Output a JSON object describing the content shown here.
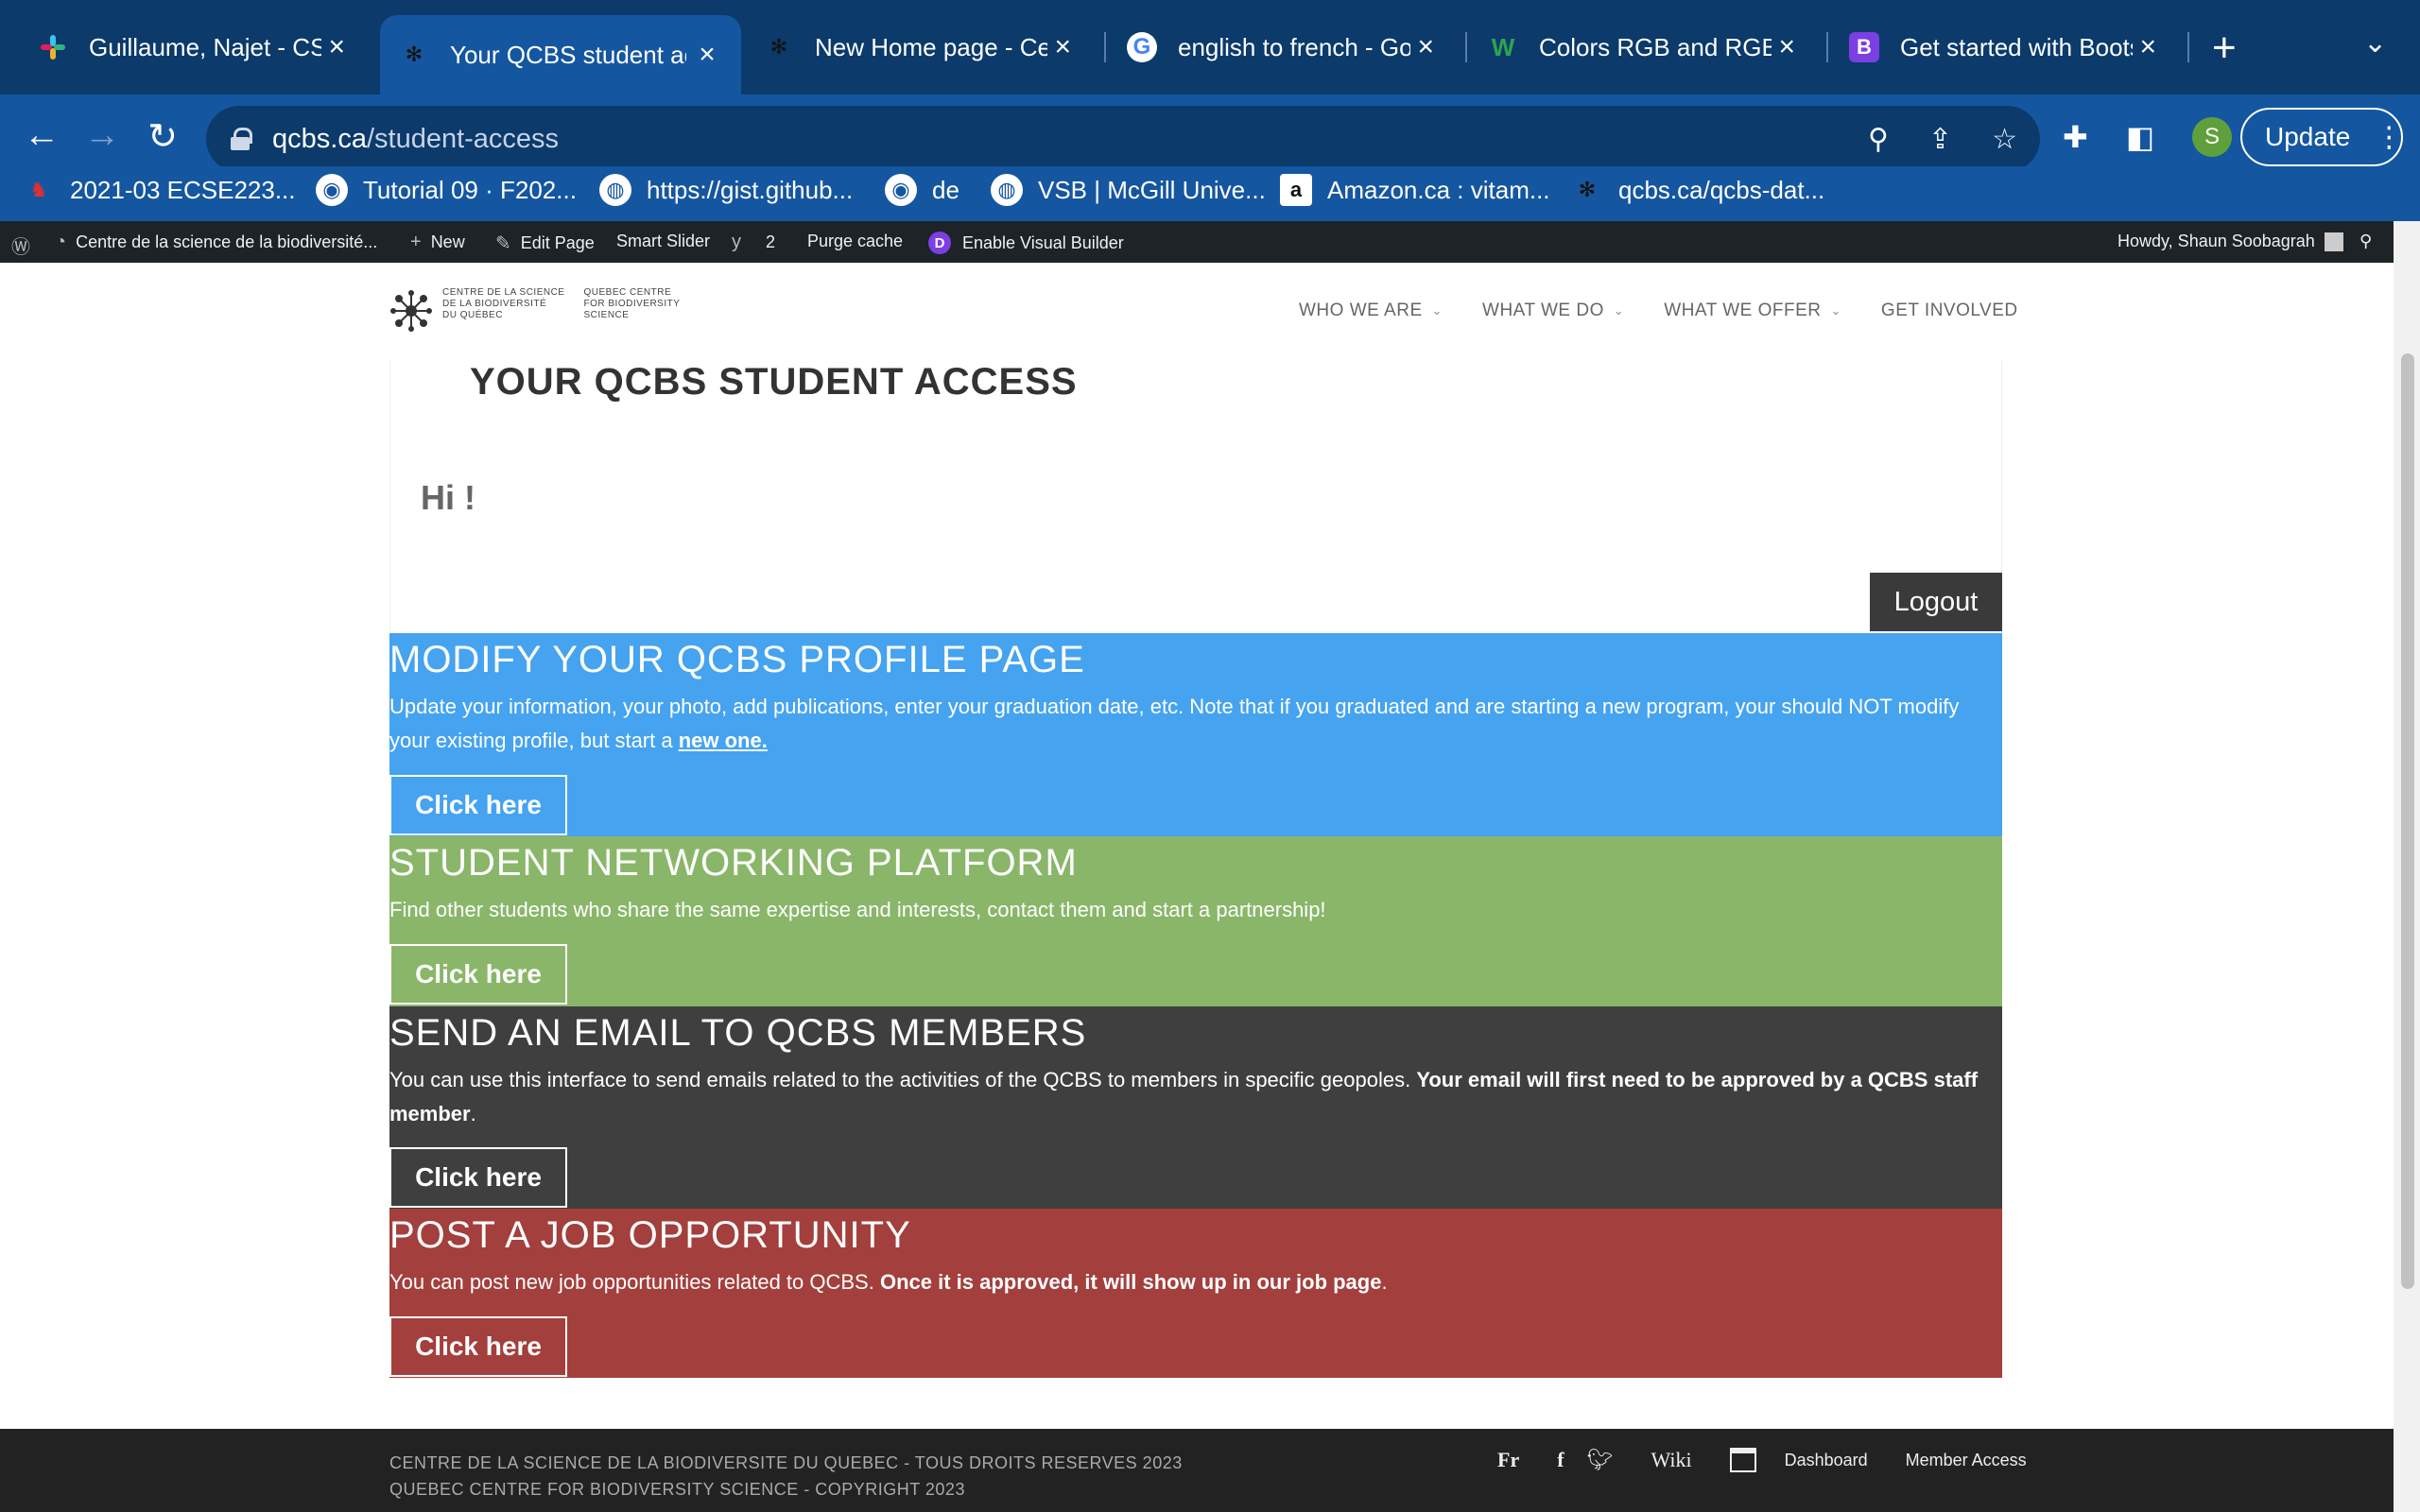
{
  "browser": {
    "tabs": [
      {
        "title": "Guillaume, Najet - CSB",
        "favicon": "slack-icon",
        "active": false
      },
      {
        "title": "Your QCBS student acc",
        "favicon": "qcbs-icon",
        "active": true
      },
      {
        "title": "New Home page - Centr",
        "favicon": "qcbs-icon",
        "active": false
      },
      {
        "title": "english to french - Goo",
        "favicon": "google-icon",
        "active": false
      },
      {
        "title": "Colors RGB and RGBA",
        "favicon": "w3schools-icon",
        "active": false
      },
      {
        "title": "Get started with Boots",
        "favicon": "bootstrap-icon",
        "active": false
      }
    ],
    "url_host": "qcbs.ca",
    "url_path": "/student-access",
    "profile_initial": "S",
    "update_label": "Update",
    "bookmarks": [
      {
        "label": "2021-03 ECSE223...",
        "icon": "sheep-icon"
      },
      {
        "label": "Tutorial 09 · F202...",
        "icon": "github-icon"
      },
      {
        "label": "https://gist.github...",
        "icon": "globe-icon"
      },
      {
        "label": "de",
        "icon": "github-icon"
      },
      {
        "label": "VSB | McGill Unive...",
        "icon": "globe-icon"
      },
      {
        "label": "Amazon.ca : vitam...",
        "icon": "amazon-icon"
      },
      {
        "label": "qcbs.ca/qcbs-dat...",
        "icon": "qcbs-icon"
      }
    ]
  },
  "adminbar": {
    "site_name": "Centre de la science de la biodiversité...",
    "new_label": "New",
    "edit_page": "Edit Page",
    "smart_slider": "Smart Slider",
    "yoast_count": "2",
    "purge_cache": "Purge cache",
    "visual_builder": "Enable Visual Builder",
    "howdy": "Howdy, Shaun Soobagrah"
  },
  "site": {
    "logo_fr": [
      "CENTRE DE LA SCIENCE",
      "DE LA BIODIVERSITÉ",
      "DU QUÉBEC"
    ],
    "logo_en": [
      "QUEBEC CENTRE",
      "FOR BIODIVERSITY",
      "SCIENCE"
    ],
    "nav": [
      {
        "label": "WHO WE ARE",
        "dropdown": true
      },
      {
        "label": "WHAT WE DO",
        "dropdown": true
      },
      {
        "label": "WHAT WE OFFER",
        "dropdown": true
      },
      {
        "label": "GET INVOLVED",
        "dropdown": false
      }
    ]
  },
  "content": {
    "page_title": "YOUR QCBS STUDENT ACCESS",
    "greeting": "Hi !",
    "logout_label": "Logout",
    "sections": [
      {
        "title": "MODIFY YOUR QCBS PROFILE PAGE",
        "body": "Update your information, your photo, add publications, enter your graduation date, etc. Note that if you graduated and are starting a new program, your should NOT modify your existing profile, but start a ",
        "link": "new one.",
        "button": "Click here",
        "color": "#45a3f0"
      },
      {
        "title": "STUDENT NETWORKING PLATFORM",
        "body": "Find other students who share the same expertise and interests, contact them and start a partnership!",
        "button": "Click here",
        "color": "#8ab66a"
      },
      {
        "title": "SEND AN EMAIL TO QCBS MEMBERS",
        "body": "You can use this interface to send emails related to the activities of the QCBS to members in specific geopoles. ",
        "bold": "Your email will first need to be approved by a QCBS staff member",
        "after": ".",
        "button": "Click here",
        "color": "#3f3f3f"
      },
      {
        "title": "POST A JOB OPPORTUNITY",
        "body": "You can post new job opportunities related to QCBS. ",
        "bold": "Once it is approved, it will show up in our job page",
        "after": ".",
        "button": "Click here",
        "color": "#a33f3c"
      }
    ]
  },
  "footer": {
    "line1": "CENTRE DE LA SCIENCE DE LA BIODIVERSITE DU QUEBEC - TOUS DROITS RESERVES 2023",
    "line2": "QUEBEC CENTRE FOR BIODIVERSITY SCIENCE - COPYRIGHT 2023",
    "lang": "Fr",
    "wiki": "Wiki",
    "dashboard": "Dashboard",
    "member_access": "Member Access"
  }
}
